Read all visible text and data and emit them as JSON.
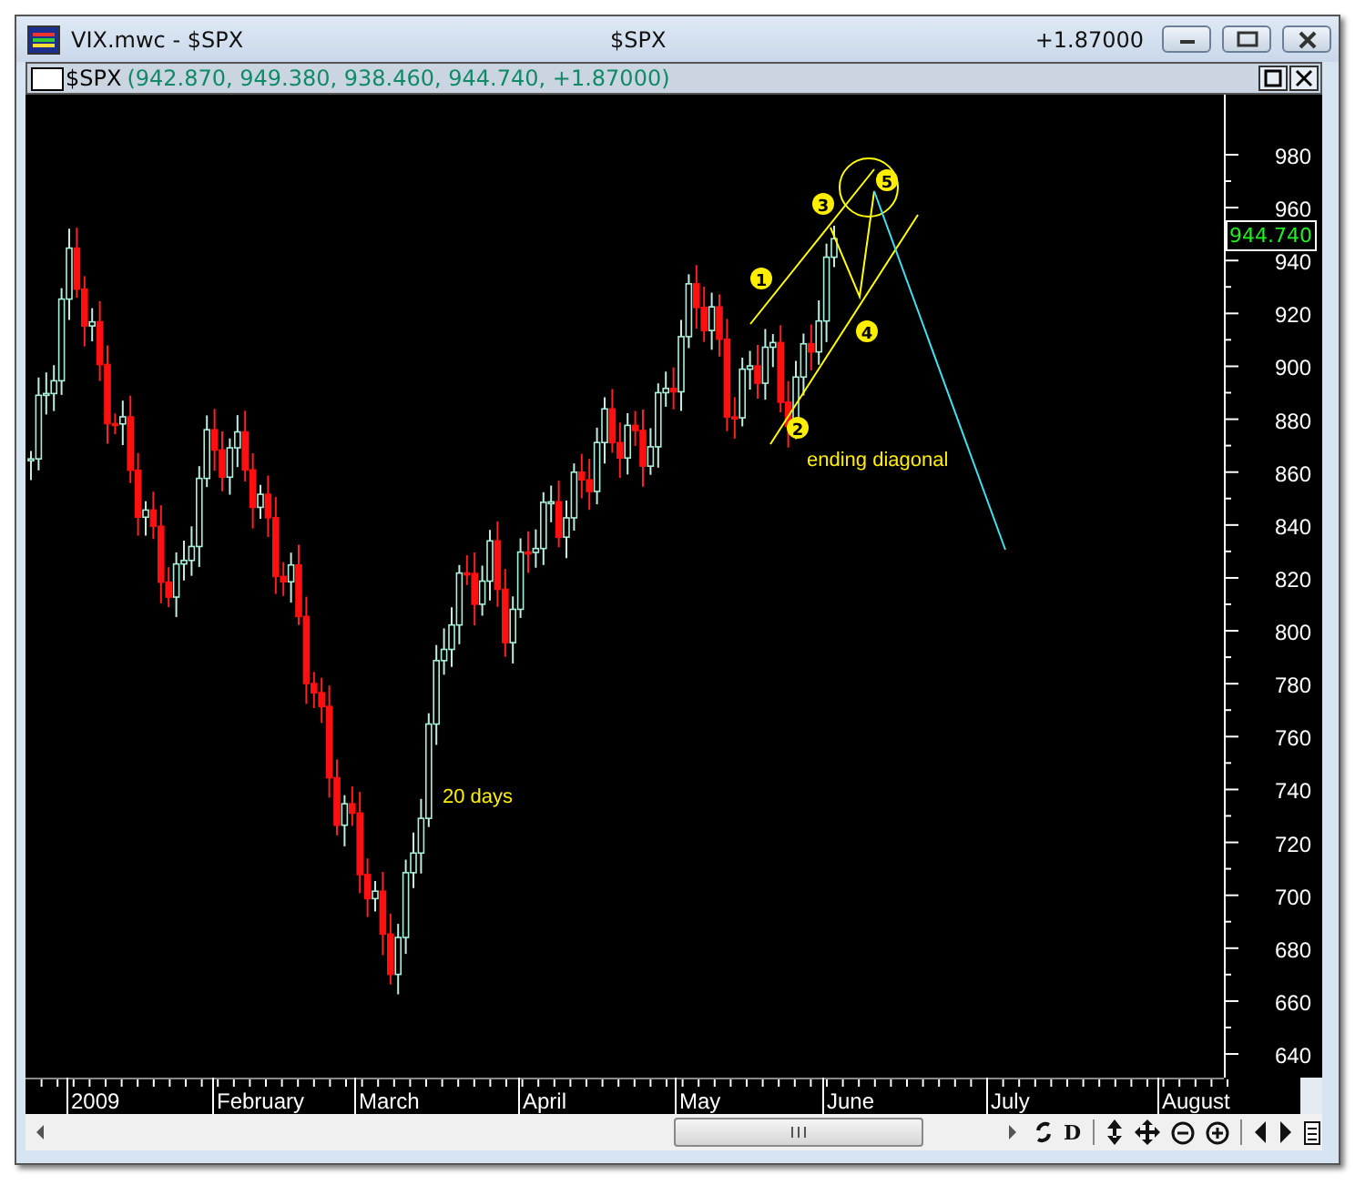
{
  "window": {
    "title": "VIX.mwc - $SPX",
    "center_title": "$SPX",
    "change": "+1.87000"
  },
  "chart_window": {
    "symbol": "$SPX",
    "ohlc": "(942.870, 949.380, 938.460, 944.740, +1.87000)"
  },
  "price_axis": {
    "labels": [
      "980",
      "960",
      "940",
      "920",
      "900",
      "880",
      "860",
      "840",
      "820",
      "800",
      "780",
      "760",
      "740",
      "720",
      "700",
      "680",
      "660",
      "640"
    ],
    "last_price": "944.740"
  },
  "annotations": {
    "waves": [
      {
        "label": "1"
      },
      {
        "label": "2"
      },
      {
        "label": "3"
      },
      {
        "label": "4"
      },
      {
        "label": "5"
      }
    ],
    "diagonal_label": "ending diagonal",
    "days_label": "20 days"
  },
  "date_axis": {
    "labels": [
      "2009",
      "February",
      "March",
      "April",
      "May",
      "June",
      "July",
      "August"
    ]
  },
  "toolbar": {
    "period_button": "D"
  }
}
